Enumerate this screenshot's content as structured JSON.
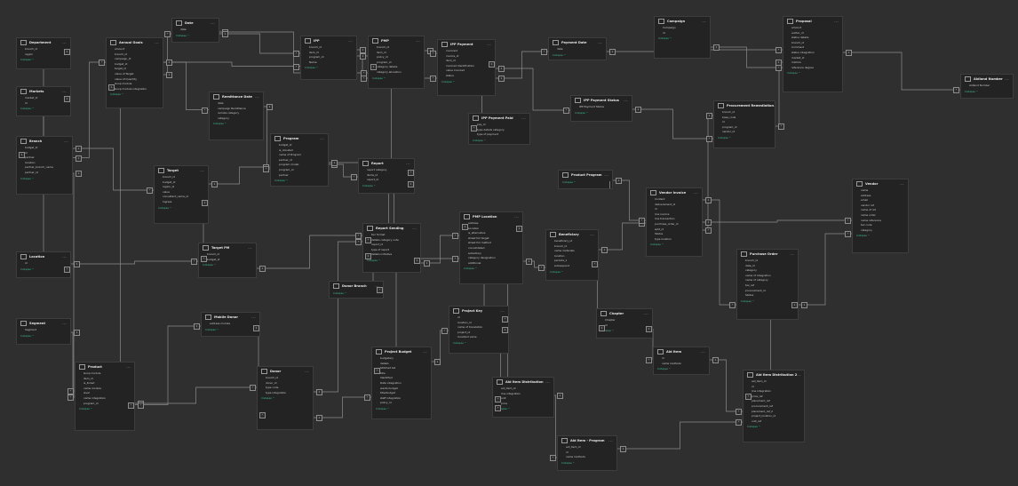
{
  "diagram": {
    "collapse_label": "Collapse ^",
    "tables": [
      {
        "id": "department",
        "name": "Department",
        "fields": [
          "branch_id",
          "region"
        ]
      },
      {
        "id": "markets",
        "name": "Markets",
        "fields": [
          "market_id",
          "id"
        ]
      },
      {
        "id": "branch",
        "name": "Branch",
        "fields": [
          "budget_id",
          "id",
          "partner",
          "location",
          "partner_branch_name",
          "partner_id"
        ]
      },
      {
        "id": "location",
        "name": "Location",
        "fields": [
          "id"
        ]
      },
      {
        "id": "segment",
        "name": "Segment",
        "fields": [
          "Segment"
        ]
      },
      {
        "id": "annual-goals",
        "name": "Annual Goals",
        "fields": [
          "amount",
          "branch_id",
          "campaign_id",
          "budget_id",
          "target_id",
          "value of Target",
          "value of Quantity",
          "Goop module",
          "Goop module integration"
        ]
      },
      {
        "id": "date",
        "name": "Date",
        "fields": [
          "date"
        ]
      },
      {
        "id": "target",
        "name": "Target",
        "fields": [
          "branch_id",
          "budget_id",
          "region_id",
          "value",
          "consultant_name_id",
          "Ingress"
        ]
      },
      {
        "id": "target-pm",
        "name": "Target PM",
        "fields": [
          "branch_id",
          "budget_id"
        ]
      },
      {
        "id": "mobile-donor",
        "name": "Mobile Donor",
        "fields": [
          "address module"
        ]
      },
      {
        "id": "product",
        "name": "Product",
        "fields": [
          "Goop module",
          "item_id",
          "is_linked",
          "name module",
          "level",
          "name integration",
          "program_id"
        ]
      },
      {
        "id": "donor",
        "name": "Donor",
        "fields": [
          "branch_id",
          "donor_id",
          "type code",
          "type integration"
        ]
      },
      {
        "id": "remittance-date",
        "name": "Remittance Date",
        "fields": [
          "date",
          "campaign Remittance",
          "remote category",
          "category"
        ]
      },
      {
        "id": "ipp",
        "name": "IPP",
        "fields": [
          "branch_id",
          "item_id",
          "program_id",
          "Name"
        ]
      },
      {
        "id": "program",
        "name": "Program",
        "fields": [
          "budget_id",
          "is_donated",
          "name of Program",
          "partner_id",
          "program model",
          "program_id",
          "partner"
        ]
      },
      {
        "id": "pmp",
        "name": "PMP",
        "fields": [
          "branch_id",
          "item_id",
          "policy_id",
          "program_id",
          "category details",
          "category allocation"
        ]
      },
      {
        "id": "report",
        "name": "Report",
        "fields": [
          "report category",
          "items_id",
          "report_id"
        ]
      },
      {
        "id": "report-sending",
        "name": "Report Sending",
        "fields": [
          "tier format",
          "details category note",
          "report_id",
          "type of report",
          "details initiative"
        ]
      },
      {
        "id": "donor-branch",
        "name": "Donor Branch",
        "fields": []
      },
      {
        "id": "project-budget",
        "name": "Project Budget",
        "fields": [
          "budgetary",
          "details",
          "Stitched list",
          "title",
          "Identified",
          "Date integration",
          "wants budget",
          "title/budget",
          "staff integration",
          "policy_id"
        ]
      },
      {
        "id": "project-key",
        "name": "Project Key",
        "fields": [
          "id",
          "location_id",
          "name of translation",
          "project_id",
          "localized value"
        ]
      },
      {
        "id": "ipp-payment",
        "name": "IPP Payment",
        "fields": [
          "invoiceid",
          "invoice_id",
          "item_id",
          "invoiced Identification",
          "value invoiced",
          "status"
        ]
      },
      {
        "id": "payment-date",
        "name": "Payment Date",
        "fields": [
          "date"
        ]
      },
      {
        "id": "ipp-payment-status",
        "name": "IPP Payment Status",
        "fields": [
          "IPP Payment Status"
        ]
      },
      {
        "id": "ipp-payment-paid",
        "name": "IPP Payment Paid",
        "fields": [
          "pay_id",
          "type details category",
          "type of payment"
        ]
      },
      {
        "id": "pmp-location",
        "name": "PMP Location",
        "fields": [
          "address",
          "Location",
          "is_alternative",
          "street full target",
          "street full method",
          "consolidated",
          "subsidiary",
          "category designation",
          "additional"
        ]
      },
      {
        "id": "beneficiary",
        "name": "Beneficiary",
        "fields": [
          "beneficiary_id",
          "branch_id",
          "name materials",
          "location",
          "periode_1",
          "subsequent"
        ]
      },
      {
        "id": "chapter",
        "name": "Chapter",
        "fields": [
          "Chapter",
          "id"
        ]
      },
      {
        "id": "aid-item-distribution",
        "name": "Aid Item Distribution",
        "fields": [
          "aid_item_id",
          "line integration",
          "unit",
          "price"
        ]
      },
      {
        "id": "aid-item-program",
        "name": "Aid Item - Program",
        "fields": [
          "aid_item_id",
          "id",
          "name methods"
        ]
      },
      {
        "id": "campaign",
        "name": "Campaign",
        "fields": [
          "Campaign",
          "id"
        ]
      },
      {
        "id": "product-program",
        "name": "Product Program",
        "fields": [
          "Product Program"
        ]
      },
      {
        "id": "vendor-invoice",
        "name": "Vendor Invoice",
        "fields": [
          "Content",
          "deliverement_id",
          "id",
          "line invoice",
          "line transaction",
          "purchase_order_id",
          "split_id",
          "Status",
          "type location"
        ]
      },
      {
        "id": "aid-item",
        "name": "Aid Item",
        "fields": [
          "id",
          "name methods"
        ]
      },
      {
        "id": "proposal",
        "name": "Proposal",
        "fields": [
          "amount",
          "author_id",
          "status details",
          "branch_id",
          "Comment",
          "status integration",
          "market_id",
          "metrics",
          "reference degree"
        ]
      },
      {
        "id": "procurement-remediation",
        "name": "Procurement Remediation",
        "fields": [
          "branch_id",
          "base_code",
          "id",
          "program_id",
          "vendor_id"
        ]
      },
      {
        "id": "vendor",
        "name": "Vendor",
        "fields": [
          "name",
          "address",
          "email",
          "vendor ref",
          "name of ref",
          "name order",
          "name reference",
          "tax code",
          "category"
        ]
      },
      {
        "id": "purchase-order",
        "name": "Purchase Order",
        "fields": [
          "branch_id",
          "date_id",
          "category",
          "name of integration",
          "name of category",
          "tax_ref",
          "procurement_id",
          "Status"
        ]
      },
      {
        "id": "aid-item-distribution-2",
        "name": "Aid Item Distribution 2",
        "fields": [
          "aid_item_id",
          "id",
          "line integration",
          "price_ref",
          "placement_ref",
          "procurement_ref",
          "placement_ref_2",
          "project_location_id",
          "unit_ref"
        ]
      },
      {
        "id": "aidland-number",
        "name": "Aidland Number",
        "fields": [
          "Aidland Number"
        ]
      }
    ],
    "relationship_markers": [
      "1",
      "*"
    ]
  }
}
